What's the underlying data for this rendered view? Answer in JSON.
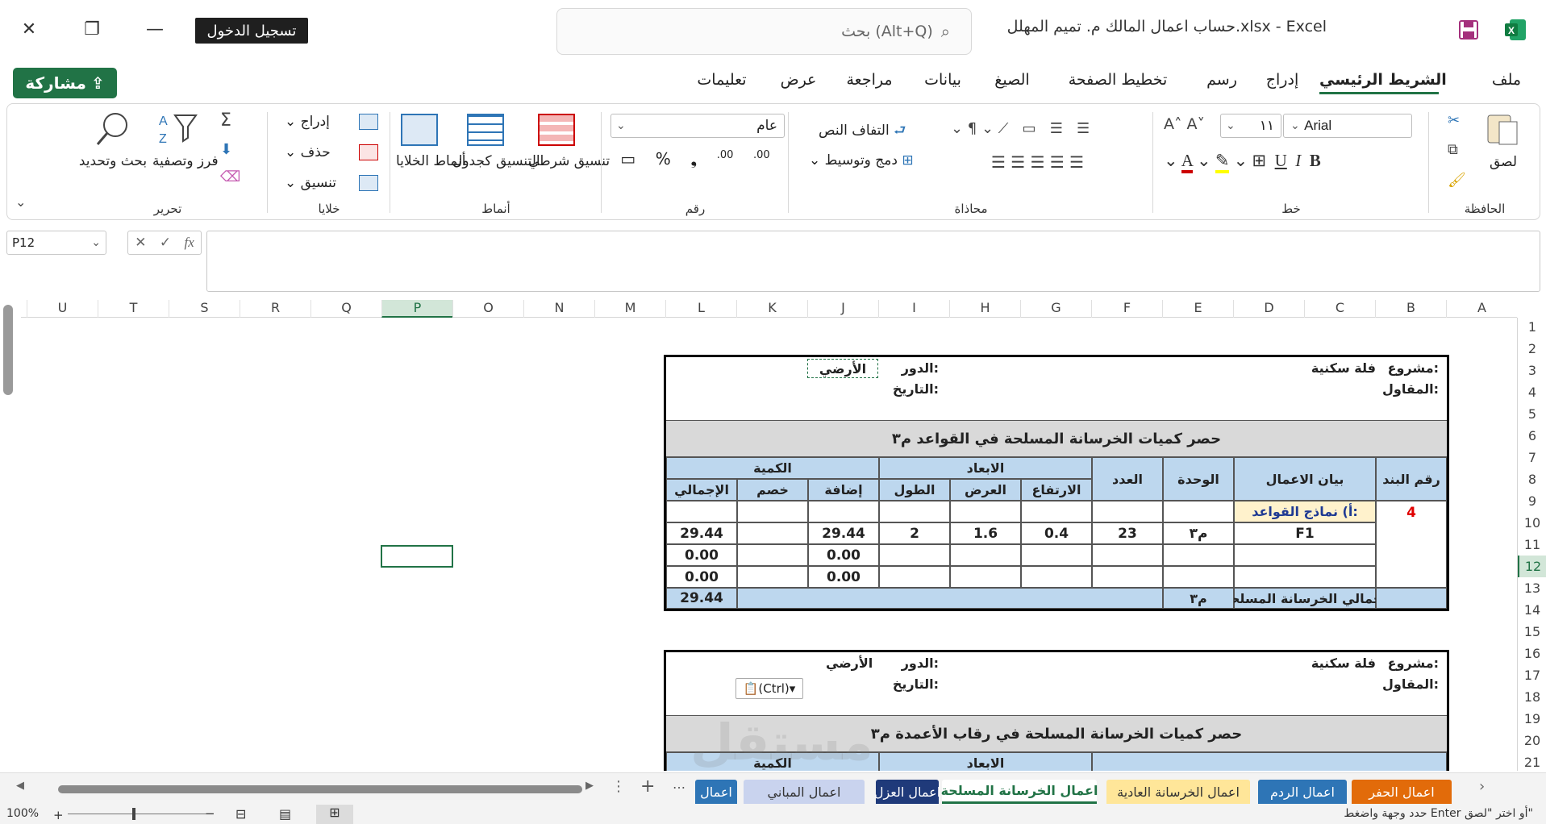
{
  "window": {
    "doc_title": "حساب اعمال المالك م. تميم المهلل.xlsx  -  Excel",
    "signin": "تسجيل الدخول",
    "search_placeholder": "بحث (Alt+Q)"
  },
  "tabs": [
    "ملف",
    "الشريط الرئيسي",
    "إدراج",
    "رسم",
    "تخطيط الصفحة",
    "الصيغ",
    "بيانات",
    "مراجعة",
    "عرض",
    "تعليمات"
  ],
  "share": "مشاركة",
  "ribbon": {
    "clipboard": {
      "label": "الحافظة",
      "paste": "لصق"
    },
    "font": {
      "label": "خط",
      "name": "Arial",
      "size": "١١"
    },
    "alignment": {
      "label": "محاذاة",
      "wrap": "التفاف النص",
      "merge": "دمج وتوسيط"
    },
    "number": {
      "label": "رقم",
      "format": "عام"
    },
    "styles": {
      "label": "أنماط",
      "conditional": "تنسيق شرطي",
      "as_table": "التنسيق كجدول",
      "cell_styles": "أنماط الخلايا"
    },
    "cells": {
      "label": "خلايا",
      "insert": "إدراج",
      "delete": "حذف",
      "format": "تنسيق"
    },
    "editing": {
      "label": "تحرير",
      "sort": "فرز وتصفية",
      "find": "بحث وتحديد"
    }
  },
  "formula": {
    "namebox": "P12",
    "value": ""
  },
  "columns": [
    "A",
    "B",
    "C",
    "D",
    "E",
    "F",
    "G",
    "H",
    "I",
    "J",
    "K",
    "L",
    "M",
    "N",
    "O",
    "P",
    "Q",
    "R",
    "S",
    "T",
    "U"
  ],
  "rows": [
    "1",
    "2",
    "3",
    "4",
    "5",
    "6",
    "7",
    "8",
    "9",
    "10",
    "11",
    "12",
    "13",
    "14",
    "15",
    "16",
    "17",
    "18",
    "19",
    "20",
    "21",
    "22"
  ],
  "selected": {
    "column": "P",
    "row": "12"
  },
  "block1": {
    "project_label": "مشروع:",
    "project": "فلة سكنية",
    "contractor_label": "المقاول:",
    "floor_label": "الدور:",
    "floor": "الأرضي",
    "date_label": "التاريخ:",
    "title": "حصر كميات الخرسانة المسلحة في القواعد م٣",
    "headers": {
      "item_no": "رقم البند",
      "desc": "بيان الاعمال",
      "unit": "الوحدة",
      "count": "العدد",
      "dims": "الابعاد",
      "length": "الطول",
      "width": "العرض",
      "height": "الارتفاع",
      "qty": "الكمية",
      "add": "إضافة",
      "deduct": "خصم",
      "total": "الإجمالي"
    },
    "item_no": "4",
    "subtitle": "أ) نماذج القواعد:",
    "rows": [
      {
        "desc": "F1",
        "unit": "م٣",
        "count": "23",
        "length": "2",
        "width": "1.6",
        "height": "0.4",
        "add": "29.44",
        "deduct": "",
        "total": "29.44"
      },
      {
        "desc": "",
        "unit": "",
        "count": "",
        "length": "",
        "width": "",
        "height": "",
        "add": "0.00",
        "deduct": "",
        "total": "0.00"
      },
      {
        "desc": "",
        "unit": "",
        "count": "",
        "length": "",
        "width": "",
        "height": "",
        "add": "0.00",
        "deduct": "",
        "total": "0.00"
      }
    ],
    "sum_label": "اجمالي الخرسانة المسلحة",
    "sum_unit": "م٣",
    "sum_total": "29.44"
  },
  "block2": {
    "project_label": "مشروع:",
    "project": "فلة سكنية",
    "contractor_label": "المقاول:",
    "floor_label": "الدور:",
    "floor": "الأرضي",
    "date_label": "التاريخ:",
    "paste_options": "(Ctrl)",
    "title": "حصر كميات الخرسانة المسلحة في رقاب الأعمدة م٣",
    "dims": "الابعاد",
    "qty": "الكمية"
  },
  "sheet_tabs": [
    {
      "label": "اعمال الحفر",
      "color": "#e26b0a",
      "text": "#fff"
    },
    {
      "label": "اعمال الردم",
      "color": "#2e75b6",
      "text": "#fff"
    },
    {
      "label": "اعمال الخرسانة العادية",
      "color": "#ffe699",
      "text": "#333"
    },
    {
      "label": "اعمال الخرسانة المسلحة",
      "color": "#ffffff",
      "text": "#217346"
    },
    {
      "label": "اعمال العزل",
      "color": "#1f3a7a",
      "text": "#fff"
    },
    {
      "label": "اعمال المباني",
      "color": "#c9d3ee",
      "text": "#333"
    },
    {
      "label": "اعمال",
      "color": "#2e75b6",
      "text": "#fff"
    }
  ],
  "status": {
    "message": "حدد وجهة واضغط Enter أو اختر \"لصق\"",
    "zoom": "100%"
  },
  "watermark": "مستقل"
}
